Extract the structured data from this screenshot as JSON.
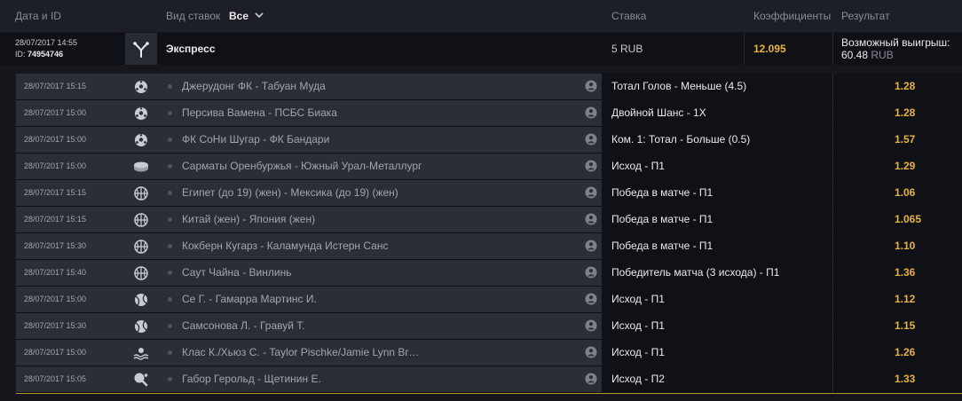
{
  "header": {
    "date_id": "Дата и ID",
    "bet_type": "Вид ставок",
    "bet_type_value": "Все",
    "stake": "Ставка",
    "coefficients": "Коэффициенты",
    "result": "Результат"
  },
  "express": {
    "date": "28/07/2017 14:55",
    "id_label": "ID:",
    "id": "74954746",
    "icon": "express-icon",
    "title": "Экспресс",
    "stake": "5 RUB",
    "coef": "12.095",
    "result_label": "Возможный выигрыш:",
    "result_value": "60.48",
    "result_currency": "RUB"
  },
  "colors": {
    "accent": "#e8b33a",
    "row_bg": "#2a2e37",
    "dark_bg": "#0f1117"
  },
  "events": [
    {
      "date": "28/07/2017 15:15",
      "sport": "football-icon",
      "team1": "Джерудонг ФК",
      "team2": "Табуан Муда",
      "market": "Тотал Голов - Меньше (4.5)",
      "coef": "1.28"
    },
    {
      "date": "28/07/2017 15:00",
      "sport": "football-icon",
      "team1": "Персива Вамена",
      "team2": "ПСБС Биака",
      "market": "Двойной Шанс - 1Х",
      "coef": "1.28"
    },
    {
      "date": "28/07/2017 15:00",
      "sport": "football-icon",
      "team1": "ФК СоНи Шугар",
      "team2": "ФК Бандари",
      "market": "Ком. 1: Тотал - Больше (0.5)",
      "coef": "1.57"
    },
    {
      "date": "28/07/2017 15:00",
      "sport": "hockey-puck-icon",
      "team1": "Сарматы Оренбуржья",
      "team2": "Южный Урал-Металлург",
      "market": "Исход - П1",
      "coef": "1.29"
    },
    {
      "date": "28/07/2017 15:15",
      "sport": "basketball-icon",
      "team1": "Египет (до 19) (жен)",
      "team2": "Мексика (до 19) (жен)",
      "market": "Победа в матче - П1",
      "coef": "1.06"
    },
    {
      "date": "28/07/2017 15:15",
      "sport": "basketball-icon",
      "team1": "Китай (жен)",
      "team2": "Япония (жен)",
      "market": "Победа в матче - П1",
      "coef": "1.065"
    },
    {
      "date": "28/07/2017 15:30",
      "sport": "basketball-icon",
      "team1": "Кокберн Кугарз",
      "team2": "Каламунда Истерн Санс",
      "market": "Победа в матче - П1",
      "coef": "1.10"
    },
    {
      "date": "28/07/2017 15:40",
      "sport": "basketball-icon",
      "team1": "Саут Чайна",
      "team2": "Винлинь",
      "market": "Победитель матча (3 исхода) - П1",
      "coef": "1.36"
    },
    {
      "date": "28/07/2017 15:00",
      "sport": "tennis-ball-icon",
      "team1": "Се Г.",
      "team2": "Гамарра Мартинс И.",
      "market": "Исход - П1",
      "coef": "1.12"
    },
    {
      "date": "28/07/2017 15:30",
      "sport": "tennis-ball-icon",
      "team1": "Самсонова Л.",
      "team2": "Гравуй Т.",
      "market": "Исход - П1",
      "coef": "1.15"
    },
    {
      "date": "28/07/2017 15:00",
      "sport": "beach-volleyball-icon",
      "team1": "Клас К./Хьюз С.",
      "team2": "Taylor Pischke/Jamie Lynn Br…",
      "market": "Исход - П1",
      "coef": "1.26"
    },
    {
      "date": "28/07/2017 15:05",
      "sport": "table-tennis-icon",
      "team1": "Габор Герольд",
      "team2": "Щетинин Е.",
      "market": "Исход - П2",
      "coef": "1.33"
    }
  ]
}
